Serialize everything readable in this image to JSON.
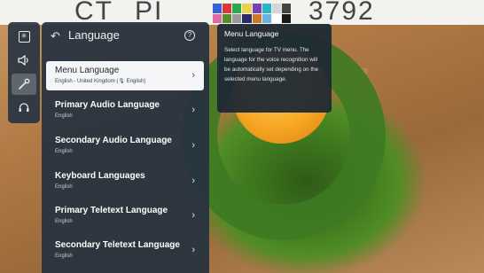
{
  "background": {
    "top_strip": [
      "CT",
      "PI",
      "3792"
    ],
    "swatches": [
      "#3b5fd6",
      "#d83a3a",
      "#2fa84a",
      "#e8d34a",
      "#7a3fb8",
      "#2bb6c8",
      "#d6d6d6",
      "#444444",
      "#e06aa0",
      "#5a8a2a",
      "#9a9a9a",
      "#2a2a6a",
      "#c87a2a",
      "#6ab0e0",
      "#ffffff",
      "#1a1a1a"
    ]
  },
  "rail": {
    "items": [
      {
        "icon": "picture-settings-icon",
        "glyph": "✳"
      },
      {
        "icon": "sound-icon",
        "glyph": "🔈︎"
      },
      {
        "icon": "general-settings-icon",
        "glyph": "✎",
        "active": true
      },
      {
        "icon": "support-headset-icon",
        "glyph": "☊"
      }
    ]
  },
  "header": {
    "back_glyph": "↶",
    "title": "Language",
    "help_glyph": "?"
  },
  "menu": {
    "items": [
      {
        "label": "Menu Language",
        "value": "English - United Kingdom (🎙 English)",
        "selected": true
      },
      {
        "label": "Primary Audio Language",
        "value": "English"
      },
      {
        "label": "Secondary Audio Language",
        "value": "English"
      },
      {
        "label": "Keyboard Languages",
        "value": "English"
      },
      {
        "label": "Primary Teletext Language",
        "value": "English"
      },
      {
        "label": "Secondary Teletext Language",
        "value": "English"
      }
    ],
    "chevron": "›"
  },
  "tooltip": {
    "title": "Menu Language",
    "body": "Select language for TV menu. The language for the voice recognition will be automatically set depending on the selected menu language."
  }
}
